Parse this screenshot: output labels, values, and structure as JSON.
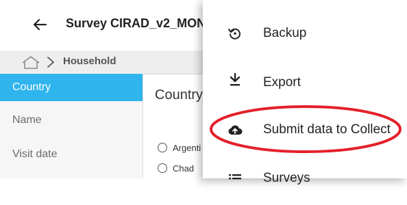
{
  "header": {
    "title": "Survey CIRAD_v2_MON",
    "back_icon": "arrow-left-icon"
  },
  "breadcrumb": {
    "home_icon": "home-icon",
    "separator_icon": "chevron-right-icon",
    "label": "Household"
  },
  "sidebar": {
    "items": [
      {
        "label": "Country",
        "active": true
      },
      {
        "label": "Name",
        "active": false
      },
      {
        "label": "Visit date",
        "active": false
      }
    ]
  },
  "main": {
    "title": "Country",
    "options": [
      "Argenti",
      "Chad"
    ]
  },
  "menu": {
    "items": [
      {
        "label": "Backup",
        "icon": "backup-restore-icon"
      },
      {
        "label": "Export",
        "icon": "download-icon"
      },
      {
        "label": "Submit data to Collect",
        "icon": "cloud-upload-icon"
      },
      {
        "label": "Surveys",
        "icon": "list-icon"
      }
    ]
  },
  "colors": {
    "accent": "#30b4ed",
    "highlight_ring": "#e3202a"
  }
}
